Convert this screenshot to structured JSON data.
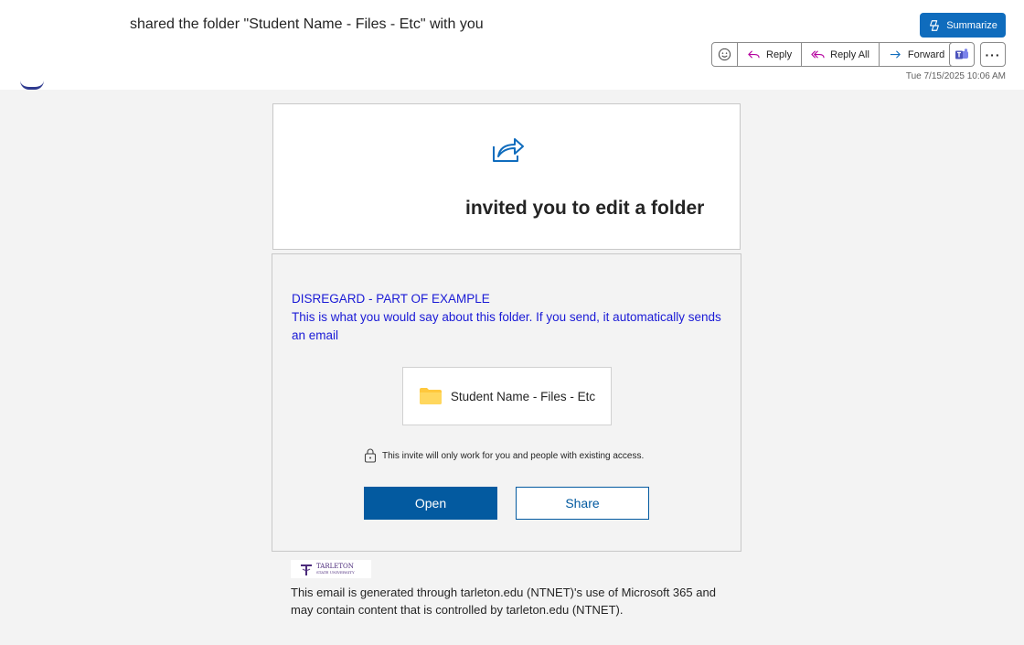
{
  "header": {
    "subject": "shared the folder \"Student Name - Files - Etc\" with you",
    "summarize_label": "Summarize",
    "actions": {
      "reply": "Reply",
      "reply_all": "Reply All",
      "forward": "Forward"
    },
    "more_label": "···",
    "timestamp": "Tue 7/15/2025 10:06 AM"
  },
  "card": {
    "headline": "invited you to edit a folder",
    "message_line1": "DISREGARD - PART OF EXAMPLE",
    "message_line2": "This is what you would say about this folder. If you send, it automatically sends an email",
    "folder_name": "Student Name - Files - Etc",
    "invite_note": "This invite will only work for you and people with existing access.",
    "open_label": "Open",
    "share_label": "Share"
  },
  "footer": {
    "logo_line1": "TARLETON",
    "logo_line2": "STATE UNIVERSITY",
    "text": "This email is generated through tarleton.edu (NTNET)'s use of Microsoft 365 and may contain content that is controlled by tarleton.edu (NTNET)."
  },
  "colors": {
    "accent": "#0f6cbd",
    "button": "#035aa0",
    "message_text": "#1a1ad6",
    "folder": "#ffc83d"
  }
}
